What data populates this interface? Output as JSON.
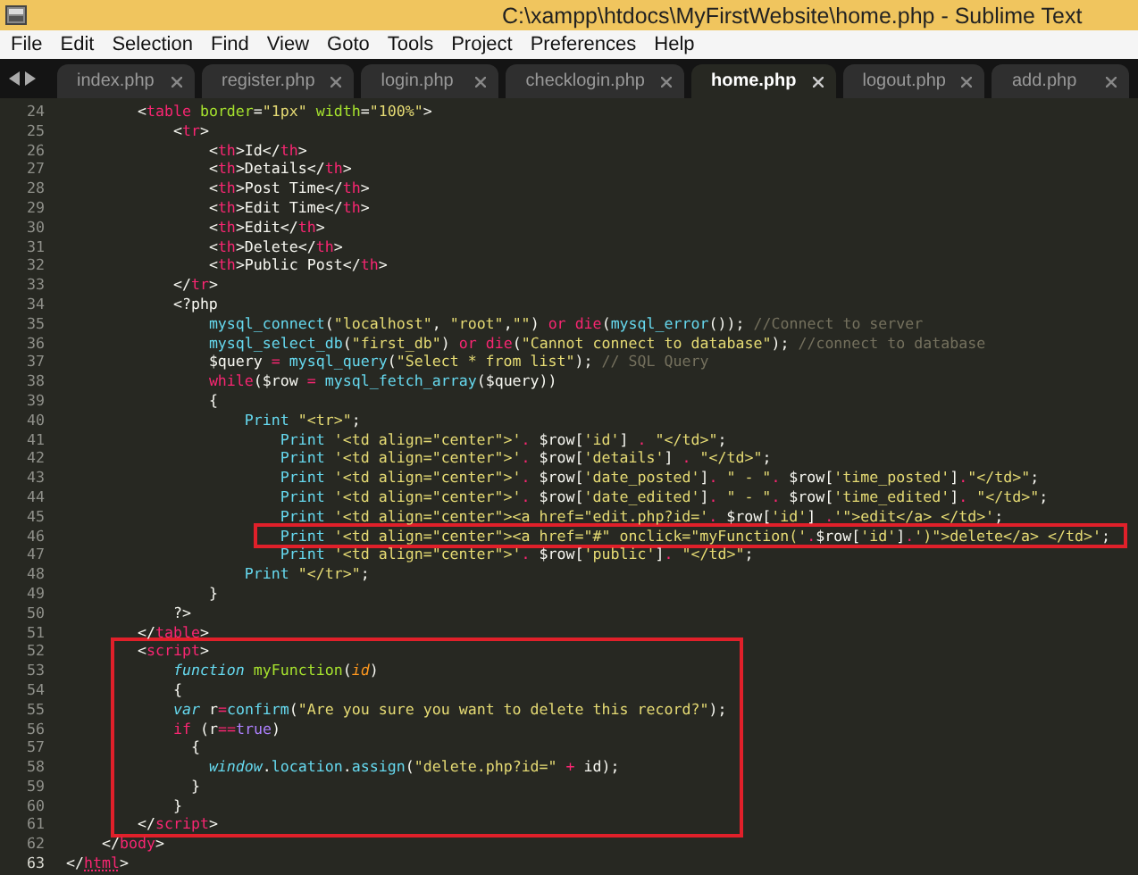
{
  "window": {
    "title": "C:\\xampp\\htdocs\\MyFirstWebsite\\home.php - Sublime Text"
  },
  "menu": [
    "File",
    "Edit",
    "Selection",
    "Find",
    "View",
    "Goto",
    "Tools",
    "Project",
    "Preferences",
    "Help"
  ],
  "tabs": [
    {
      "label": "index.php",
      "selected": false
    },
    {
      "label": "register.php",
      "selected": false
    },
    {
      "label": "login.php",
      "selected": false
    },
    {
      "label": "checklogin.php",
      "selected": false
    },
    {
      "label": "home.php",
      "selected": true
    },
    {
      "label": "logout.php",
      "selected": false
    },
    {
      "label": "add.php",
      "selected": false
    }
  ],
  "editor": {
    "blocks": [
      {
        "kind": "plain",
        "lines": [
          {
            "number": "24",
            "current": false,
            "tokens": [
              {
                "kind": "plain",
                "text": "        <"
              },
              {
                "kind": "tag",
                "text": "table"
              },
              {
                "kind": "attr",
                "text": " border"
              },
              {
                "kind": "plain",
                "text": "="
              },
              {
                "kind": "str",
                "text": "\"1px\""
              },
              {
                "kind": "attr",
                "text": " width"
              },
              {
                "kind": "plain",
                "text": "="
              },
              {
                "kind": "str",
                "text": "\"100%\""
              },
              {
                "kind": "plain",
                "text": ">"
              }
            ]
          },
          {
            "number": "25",
            "current": false,
            "tokens": [
              {
                "kind": "plain",
                "text": "            <"
              },
              {
                "kind": "tag",
                "text": "tr"
              },
              {
                "kind": "plain",
                "text": ">"
              }
            ]
          },
          {
            "number": "26",
            "current": false,
            "tokens": [
              {
                "kind": "plain",
                "text": "                <"
              },
              {
                "kind": "tag",
                "text": "th"
              },
              {
                "kind": "plain",
                "text": ">Id</"
              },
              {
                "kind": "tag",
                "text": "th"
              },
              {
                "kind": "plain",
                "text": ">"
              }
            ]
          },
          {
            "number": "27",
            "current": false,
            "tokens": [
              {
                "kind": "plain",
                "text": "                <"
              },
              {
                "kind": "tag",
                "text": "th"
              },
              {
                "kind": "plain",
                "text": ">Details</"
              },
              {
                "kind": "tag",
                "text": "th"
              },
              {
                "kind": "plain",
                "text": ">"
              }
            ]
          },
          {
            "number": "28",
            "current": false,
            "tokens": [
              {
                "kind": "plain",
                "text": "                <"
              },
              {
                "kind": "tag",
                "text": "th"
              },
              {
                "kind": "plain",
                "text": ">Post Time</"
              },
              {
                "kind": "tag",
                "text": "th"
              },
              {
                "kind": "plain",
                "text": ">"
              }
            ]
          },
          {
            "number": "29",
            "current": false,
            "tokens": [
              {
                "kind": "plain",
                "text": "                <"
              },
              {
                "kind": "tag",
                "text": "th"
              },
              {
                "kind": "plain",
                "text": ">Edit Time</"
              },
              {
                "kind": "tag",
                "text": "th"
              },
              {
                "kind": "plain",
                "text": ">"
              }
            ]
          },
          {
            "number": "30",
            "current": false,
            "tokens": [
              {
                "kind": "plain",
                "text": "                <"
              },
              {
                "kind": "tag",
                "text": "th"
              },
              {
                "kind": "plain",
                "text": ">Edit</"
              },
              {
                "kind": "tag",
                "text": "th"
              },
              {
                "kind": "plain",
                "text": ">"
              }
            ]
          },
          {
            "number": "31",
            "current": false,
            "tokens": [
              {
                "kind": "plain",
                "text": "                <"
              },
              {
                "kind": "tag",
                "text": "th"
              },
              {
                "kind": "plain",
                "text": ">Delete</"
              },
              {
                "kind": "tag",
                "text": "th"
              },
              {
                "kind": "plain",
                "text": ">"
              }
            ]
          },
          {
            "number": "32",
            "current": false,
            "tokens": [
              {
                "kind": "plain",
                "text": "                <"
              },
              {
                "kind": "tag",
                "text": "th"
              },
              {
                "kind": "plain",
                "text": ">Public Post</"
              },
              {
                "kind": "tag",
                "text": "th"
              },
              {
                "kind": "plain",
                "text": ">"
              }
            ]
          },
          {
            "number": "33",
            "current": false,
            "tokens": [
              {
                "kind": "plain",
                "text": "            </"
              },
              {
                "kind": "tag",
                "text": "tr"
              },
              {
                "kind": "plain",
                "text": ">"
              }
            ]
          },
          {
            "number": "34",
            "current": false,
            "tokens": [
              {
                "kind": "plain",
                "text": "            <?php"
              }
            ]
          },
          {
            "number": "35",
            "current": false,
            "tokens": [
              {
                "kind": "fn",
                "text": "                mysql_connect"
              },
              {
                "kind": "plain",
                "text": "("
              },
              {
                "kind": "str",
                "text": "\"localhost\""
              },
              {
                "kind": "plain",
                "text": ", "
              },
              {
                "kind": "str",
                "text": "\"root\""
              },
              {
                "kind": "plain",
                "text": ","
              },
              {
                "kind": "str",
                "text": "\"\""
              },
              {
                "kind": "plain",
                "text": ") "
              },
              {
                "kind": "kw",
                "text": "or "
              },
              {
                "kind": "kw",
                "text": "die"
              },
              {
                "kind": "plain",
                "text": "("
              },
              {
                "kind": "fn",
                "text": "mysql_error"
              },
              {
                "kind": "plain",
                "text": "()); "
              },
              {
                "kind": "comment",
                "text": "//Connect to server"
              }
            ]
          },
          {
            "number": "36",
            "current": false,
            "tokens": [
              {
                "kind": "fn",
                "text": "                mysql_select_db"
              },
              {
                "kind": "plain",
                "text": "("
              },
              {
                "kind": "str",
                "text": "\"first_db\""
              },
              {
                "kind": "plain",
                "text": ") "
              },
              {
                "kind": "kw",
                "text": "or "
              },
              {
                "kind": "kw",
                "text": "die"
              },
              {
                "kind": "plain",
                "text": "("
              },
              {
                "kind": "str",
                "text": "\"Cannot connect to database\""
              },
              {
                "kind": "plain",
                "text": "); "
              },
              {
                "kind": "comment",
                "text": "//connect to database"
              }
            ]
          },
          {
            "number": "37",
            "current": false,
            "tokens": [
              {
                "kind": "plain",
                "text": "                $query "
              },
              {
                "kind": "kw",
                "text": "= "
              },
              {
                "kind": "fn",
                "text": "mysql_query"
              },
              {
                "kind": "plain",
                "text": "("
              },
              {
                "kind": "str",
                "text": "\"Select * from list\""
              },
              {
                "kind": "plain",
                "text": "); "
              },
              {
                "kind": "comment",
                "text": "// SQL Query"
              }
            ]
          },
          {
            "number": "38",
            "current": false,
            "tokens": [
              {
                "kind": "kw",
                "text": "                while"
              },
              {
                "kind": "plain",
                "text": "($row "
              },
              {
                "kind": "kw",
                "text": "= "
              },
              {
                "kind": "fn",
                "text": "mysql_fetch_array"
              },
              {
                "kind": "plain",
                "text": "($query))"
              }
            ]
          },
          {
            "number": "39",
            "current": false,
            "tokens": [
              {
                "kind": "plain",
                "text": "                {"
              }
            ]
          },
          {
            "number": "40",
            "current": false,
            "tokens": [
              {
                "kind": "fn",
                "text": "                    Print "
              },
              {
                "kind": "str",
                "text": "\"<tr>\""
              },
              {
                "kind": "plain",
                "text": ";"
              }
            ]
          },
          {
            "number": "41",
            "current": false,
            "tokens": [
              {
                "kind": "fn",
                "text": "                        Print "
              },
              {
                "kind": "str",
                "text": "'<td align=\"center\">'"
              },
              {
                "kind": "kw",
                "text": "."
              },
              {
                "kind": "plain",
                "text": " $row["
              },
              {
                "kind": "str",
                "text": "'id'"
              },
              {
                "kind": "plain",
                "text": "] "
              },
              {
                "kind": "kw",
                "text": ". "
              },
              {
                "kind": "str",
                "text": "\"</td>\""
              },
              {
                "kind": "plain",
                "text": ";"
              }
            ]
          },
          {
            "number": "42",
            "current": false,
            "tokens": [
              {
                "kind": "fn",
                "text": "                        Print "
              },
              {
                "kind": "str",
                "text": "'<td align=\"center\">'"
              },
              {
                "kind": "kw",
                "text": "."
              },
              {
                "kind": "plain",
                "text": " $row["
              },
              {
                "kind": "str",
                "text": "'details'"
              },
              {
                "kind": "plain",
                "text": "] "
              },
              {
                "kind": "kw",
                "text": ". "
              },
              {
                "kind": "str",
                "text": "\"</td>\""
              },
              {
                "kind": "plain",
                "text": ";"
              }
            ]
          },
          {
            "number": "43",
            "current": false,
            "tokens": [
              {
                "kind": "fn",
                "text": "                        Print "
              },
              {
                "kind": "str",
                "text": "'<td align=\"center\">'"
              },
              {
                "kind": "kw",
                "text": "."
              },
              {
                "kind": "plain",
                "text": " $row["
              },
              {
                "kind": "str",
                "text": "'date_posted'"
              },
              {
                "kind": "plain",
                "text": "]"
              },
              {
                "kind": "kw",
                "text": ". "
              },
              {
                "kind": "str",
                "text": "\" - \""
              },
              {
                "kind": "kw",
                "text": "."
              },
              {
                "kind": "plain",
                "text": " $row["
              },
              {
                "kind": "str",
                "text": "'time_posted'"
              },
              {
                "kind": "plain",
                "text": "]"
              },
              {
                "kind": "kw",
                "text": "."
              },
              {
                "kind": "str",
                "text": "\"</td>\""
              },
              {
                "kind": "plain",
                "text": ";"
              }
            ]
          },
          {
            "number": "44",
            "current": false,
            "tokens": [
              {
                "kind": "fn",
                "text": "                        Print "
              },
              {
                "kind": "str",
                "text": "'<td align=\"center\">'"
              },
              {
                "kind": "kw",
                "text": "."
              },
              {
                "kind": "plain",
                "text": " $row["
              },
              {
                "kind": "str",
                "text": "'date_edited'"
              },
              {
                "kind": "plain",
                "text": "]"
              },
              {
                "kind": "kw",
                "text": ". "
              },
              {
                "kind": "str",
                "text": "\" - \""
              },
              {
                "kind": "kw",
                "text": "."
              },
              {
                "kind": "plain",
                "text": " $row["
              },
              {
                "kind": "str",
                "text": "'time_edited'"
              },
              {
                "kind": "plain",
                "text": "]"
              },
              {
                "kind": "kw",
                "text": ". "
              },
              {
                "kind": "str",
                "text": "\"</td>\""
              },
              {
                "kind": "plain",
                "text": ";"
              }
            ]
          },
          {
            "number": "45",
            "current": false,
            "tokens": [
              {
                "kind": "fn",
                "text": "                        Print "
              },
              {
                "kind": "str",
                "text": "'<td align=\"center\"><a href=\"edit.php?id='"
              },
              {
                "kind": "kw",
                "text": "."
              },
              {
                "kind": "plain",
                "text": " $row["
              },
              {
                "kind": "str",
                "text": "'id'"
              },
              {
                "kind": "plain",
                "text": "] "
              },
              {
                "kind": "kw",
                "text": "."
              },
              {
                "kind": "str",
                "text": "'\">edit</a> </td>'"
              },
              {
                "kind": "plain",
                "text": ";"
              }
            ]
          }
        ]
      },
      {
        "kind": "boxed",
        "lines": [
          {
            "number": "46",
            "current": false,
            "tokens": [
              {
                "kind": "fn",
                "text": "                        Print "
              },
              {
                "kind": "str",
                "text": "'<td align=\"center\"><a href=\"#\" onclick=\"myFunction('"
              },
              {
                "kind": "kw",
                "text": "."
              },
              {
                "kind": "plain",
                "text": "$row["
              },
              {
                "kind": "str",
                "text": "'id'"
              },
              {
                "kind": "plain",
                "text": "]"
              },
              {
                "kind": "kw",
                "text": "."
              },
              {
                "kind": "str",
                "text": "')\">delete</a> </td>'"
              },
              {
                "kind": "plain",
                "text": ";"
              }
            ]
          }
        ]
      },
      {
        "kind": "plain",
        "lines": [
          {
            "number": "47",
            "current": false,
            "tokens": [
              {
                "kind": "fn",
                "text": "                        Print "
              },
              {
                "kind": "str",
                "text": "'<td align=\"center\">'"
              },
              {
                "kind": "kw",
                "text": "."
              },
              {
                "kind": "plain",
                "text": " $row["
              },
              {
                "kind": "str",
                "text": "'public'"
              },
              {
                "kind": "plain",
                "text": "]"
              },
              {
                "kind": "kw",
                "text": ". "
              },
              {
                "kind": "str",
                "text": "\"</td>\""
              },
              {
                "kind": "plain",
                "text": ";"
              }
            ]
          },
          {
            "number": "48",
            "current": false,
            "tokens": [
              {
                "kind": "fn",
                "text": "                    Print "
              },
              {
                "kind": "str",
                "text": "\"</tr>\""
              },
              {
                "kind": "plain",
                "text": ";"
              }
            ]
          },
          {
            "number": "49",
            "current": false,
            "tokens": [
              {
                "kind": "plain",
                "text": "                }"
              }
            ]
          },
          {
            "number": "50",
            "current": false,
            "tokens": [
              {
                "kind": "plain",
                "text": "            ?>"
              }
            ]
          },
          {
            "number": "51",
            "current": false,
            "tokens": [
              {
                "kind": "plain",
                "text": "        </"
              },
              {
                "kind": "tag",
                "text": "table"
              },
              {
                "kind": "plain",
                "text": ">"
              }
            ]
          }
        ]
      },
      {
        "kind": "boxed",
        "lines": [
          {
            "number": "52",
            "current": false,
            "tokens": [
              {
                "kind": "plain",
                "text": "        <"
              },
              {
                "kind": "tag",
                "text": "script"
              },
              {
                "kind": "plain",
                "text": ">"
              }
            ]
          },
          {
            "number": "53",
            "current": false,
            "tokens": [
              {
                "kind": "storage",
                "text": "            function "
              },
              {
                "kind": "entity",
                "text": "myFunction"
              },
              {
                "kind": "plain",
                "text": "("
              },
              {
                "kind": "param",
                "text": "id"
              },
              {
                "kind": "plain",
                "text": ")"
              }
            ]
          },
          {
            "number": "54",
            "current": false,
            "tokens": [
              {
                "kind": "plain",
                "text": "            {"
              }
            ]
          },
          {
            "number": "55",
            "current": false,
            "tokens": [
              {
                "kind": "storage",
                "text": "            var"
              },
              {
                "kind": "plain",
                "text": " r"
              },
              {
                "kind": "kw",
                "text": "="
              },
              {
                "kind": "fn",
                "text": "confirm"
              },
              {
                "kind": "plain",
                "text": "("
              },
              {
                "kind": "str",
                "text": "\"Are you sure you want to delete this record?\""
              },
              {
                "kind": "plain",
                "text": ");"
              }
            ]
          },
          {
            "number": "56",
            "current": false,
            "tokens": [
              {
                "kind": "kw",
                "text": "            if"
              },
              {
                "kind": "plain",
                "text": " (r"
              },
              {
                "kind": "kw",
                "text": "=="
              },
              {
                "kind": "num",
                "text": "true"
              },
              {
                "kind": "plain",
                "text": ")"
              }
            ]
          },
          {
            "number": "57",
            "current": false,
            "tokens": [
              {
                "kind": "plain",
                "text": "              {"
              }
            ]
          },
          {
            "number": "58",
            "current": false,
            "tokens": [
              {
                "kind": "storage",
                "text": "                window"
              },
              {
                "kind": "plain",
                "text": "."
              },
              {
                "kind": "fn",
                "text": "location"
              },
              {
                "kind": "plain",
                "text": "."
              },
              {
                "kind": "fn",
                "text": "assign"
              },
              {
                "kind": "plain",
                "text": "("
              },
              {
                "kind": "str",
                "text": "\"delete.php?id=\" "
              },
              {
                "kind": "kw",
                "text": "+"
              },
              {
                "kind": "plain",
                "text": " id);"
              }
            ]
          },
          {
            "number": "59",
            "current": false,
            "tokens": [
              {
                "kind": "plain",
                "text": "              }"
              }
            ]
          },
          {
            "number": "60",
            "current": false,
            "tokens": [
              {
                "kind": "plain",
                "text": "            }"
              }
            ]
          },
          {
            "number": "61",
            "current": false,
            "tokens": [
              {
                "kind": "plain",
                "text": "        </"
              },
              {
                "kind": "tag",
                "text": "script"
              },
              {
                "kind": "plain",
                "text": ">"
              }
            ]
          }
        ]
      },
      {
        "kind": "plain",
        "lines": [
          {
            "number": "62",
            "current": false,
            "tokens": [
              {
                "kind": "plain",
                "text": "    </"
              },
              {
                "kind": "tag",
                "text": "body"
              },
              {
                "kind": "plain",
                "text": ">"
              }
            ]
          },
          {
            "number": "63",
            "current": true,
            "tokens": [
              {
                "kind": "plain",
                "text": "</"
              },
              {
                "kind": "tag",
                "text": "html"
              },
              {
                "kind": "plain",
                "text": ">"
              }
            ]
          }
        ]
      }
    ]
  }
}
